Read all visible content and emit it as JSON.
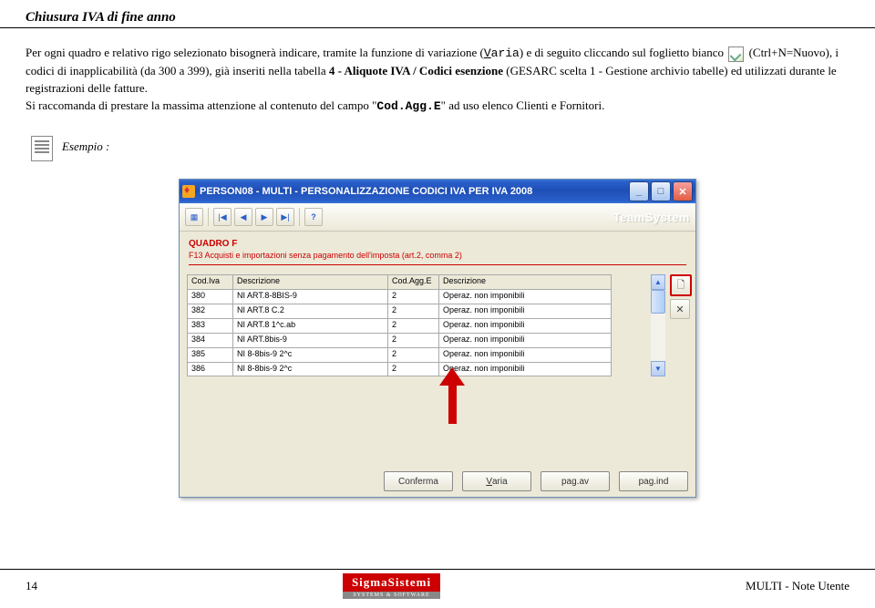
{
  "doc_header": "Chiusura IVA di fine anno",
  "para": {
    "p1a": "Per ogni quadro e relativo rigo selezionato bisognerà indicare, tramite la funzione di variazione (",
    "p1_varia": "Varia",
    "p1b": ") e di seguito cliccando sul foglietto bianco",
    "p1c": " (Ctrl+N=Nuovo), i codici di inapplicabilità (da 300 a 399), già inseriti nella tabella ",
    "p1_bold": "4 - Aliquote IVA / Codici esenzione",
    "p1d": " (GESARC scelta 1 - Gestione archivio tabelle) ed utilizzati durante le registrazioni delle fatture.",
    "p2a": "Si raccomanda di prestare la massima attenzione al contenuto del campo \"",
    "p2_code": "Cod.Agg.E",
    "p2b": "\" ad uso elenco Clienti e Fornitori."
  },
  "example_label": "Esempio :",
  "window": {
    "title": "PERSON08 - MULTI - PERSONALIZZAZIONE CODICI IVA PER IVA 2008",
    "brand": "TeamSystem"
  },
  "section": {
    "title": "QUADRO F",
    "subtitle": "F13 Acquisti e importazioni senza pagamento dell'imposta (art.2, comma 2)"
  },
  "table": {
    "headers": [
      "Cod.Iva",
      "Descrizione",
      "Cod.Agg.E",
      "Descrizione"
    ],
    "rows": [
      [
        "380",
        "NI ART.8-8BIS-9",
        "2",
        "Operaz. non imponibili"
      ],
      [
        "382",
        "NI ART.8 C.2",
        "2",
        "Operaz. non imponibili"
      ],
      [
        "383",
        "NI ART.8 1^c.ab",
        "2",
        "Operaz. non imponibili"
      ],
      [
        "384",
        "NI ART.8bis-9",
        "2",
        "Operaz. non imponibili"
      ],
      [
        "385",
        "NI 8-8bis-9 2^c",
        "2",
        "Operaz. non imponibili"
      ],
      [
        "386",
        "NI 8-8bis-9 2^c",
        "2",
        "Operaz. non imponibili"
      ]
    ]
  },
  "buttons": {
    "conferma": "Conferma",
    "varia": "Varia",
    "pagav": "pag.av",
    "pagind": "pag.ind"
  },
  "footer": {
    "page": "14",
    "right": "MULTI - Note Utente",
    "logo": "SigmaSistemi",
    "logo_sub": "SYSTEMS & SOFTWARE"
  }
}
